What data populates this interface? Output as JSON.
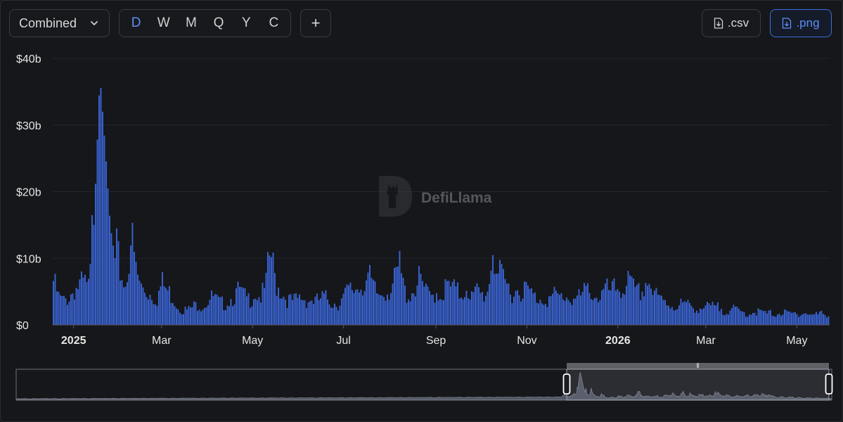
{
  "toolbar": {
    "dropdown_label": "Combined",
    "periods": [
      "D",
      "W",
      "M",
      "Q",
      "Y",
      "C"
    ],
    "active_period": "D",
    "plus_label": "+",
    "csv_label": ".csv",
    "png_label": ".png",
    "accent_color": "#5b8ff7"
  },
  "watermark": {
    "text": "DefiLlama"
  },
  "chart_data": {
    "type": "bar",
    "y_tick_labels": [
      "$0",
      "$10b",
      "$20b",
      "$30b",
      "$40b"
    ],
    "ylim": [
      0,
      40
    ],
    "x_tick_labels": [
      {
        "label": "2025",
        "bold": true,
        "date": "2025-01-01"
      },
      {
        "label": "Mar",
        "bold": false,
        "date": "2025-03-01"
      },
      {
        "label": "May",
        "bold": false,
        "date": "2025-05-01"
      },
      {
        "label": "Jul",
        "bold": false,
        "date": "2025-07-01"
      },
      {
        "label": "Sep",
        "bold": false,
        "date": "2025-09-01"
      },
      {
        "label": "Nov",
        "bold": false,
        "date": "2025-11-01"
      },
      {
        "label": "2026",
        "bold": true,
        "date": "2026-01-01"
      },
      {
        "label": "Mar",
        "bold": false,
        "date": "2026-03-01"
      },
      {
        "label": "May",
        "bold": false,
        "date": "2026-05-01"
      }
    ],
    "x_start_date": "2024-12-18",
    "x_end_date": "2026-05-23",
    "series": [
      {
        "color": "#3b65d6",
        "weekly_values": [
          5.4,
          3.4,
          2.9,
          3.4,
          4.4,
          4.8,
          5.1,
          4.3,
          18,
          37.5,
          27,
          15,
          9.5,
          6.5,
          4.7,
          11.2,
          6.5,
          4.6,
          4.1,
          3.8,
          3.2,
          5.1,
          4.2,
          3.6,
          2.4,
          1.9,
          1.8,
          2.2,
          2.6,
          2.4,
          3.1,
          3.4,
          2.7,
          2.6,
          3.1,
          3.6,
          4.2,
          3.4,
          3.1,
          4.1,
          3.4,
          4.3,
          9.0,
          5.2,
          4.3,
          3.3,
          2.9,
          3.0,
          3.4,
          3.1,
          3.1,
          2.9,
          3.3,
          3.2,
          2.8,
          2.6,
          3.2,
          4.1,
          4.3,
          4.8,
          5.2,
          5.8,
          4.3,
          3.6,
          4.3,
          4.4,
          5.2,
          7.1,
          4.0,
          3.7,
          4.7,
          5.6,
          4.0,
          3.3,
          4.2,
          3.6,
          4.6,
          4.6,
          4.1,
          3.7,
          5.0,
          3.3,
          4.1,
          3.6,
          4.1,
          9.5,
          6.3,
          5.3,
          4.6,
          4.0,
          4.5,
          4.4,
          4.2,
          3.4,
          3.3,
          3.4,
          3.1,
          3.6,
          3.4,
          3.6,
          3.3,
          3.2,
          3.4,
          4.1,
          4.5,
          3.4,
          3.6,
          4.3,
          4.0,
          4.6,
          4.3,
          5.5,
          4.5,
          3.8,
          4.2,
          5.8,
          4.1,
          3.2,
          2.9,
          2.7,
          2.3,
          2.5,
          2.6,
          2.3,
          2.2,
          2.1,
          2.1,
          2.2,
          2.1,
          2.1,
          1.8,
          1.9,
          1.8,
          1.6,
          1.4,
          1.5,
          1.7,
          1.5,
          1.4,
          1.4,
          1.4,
          1.5,
          1.4,
          1.3,
          1.5,
          1.5,
          1.4,
          1.2,
          1.3,
          1.5,
          1.1
        ]
      }
    ],
    "overview_brush": {
      "start_date": "2025-12-03",
      "end_date": "2026-05-23"
    }
  }
}
